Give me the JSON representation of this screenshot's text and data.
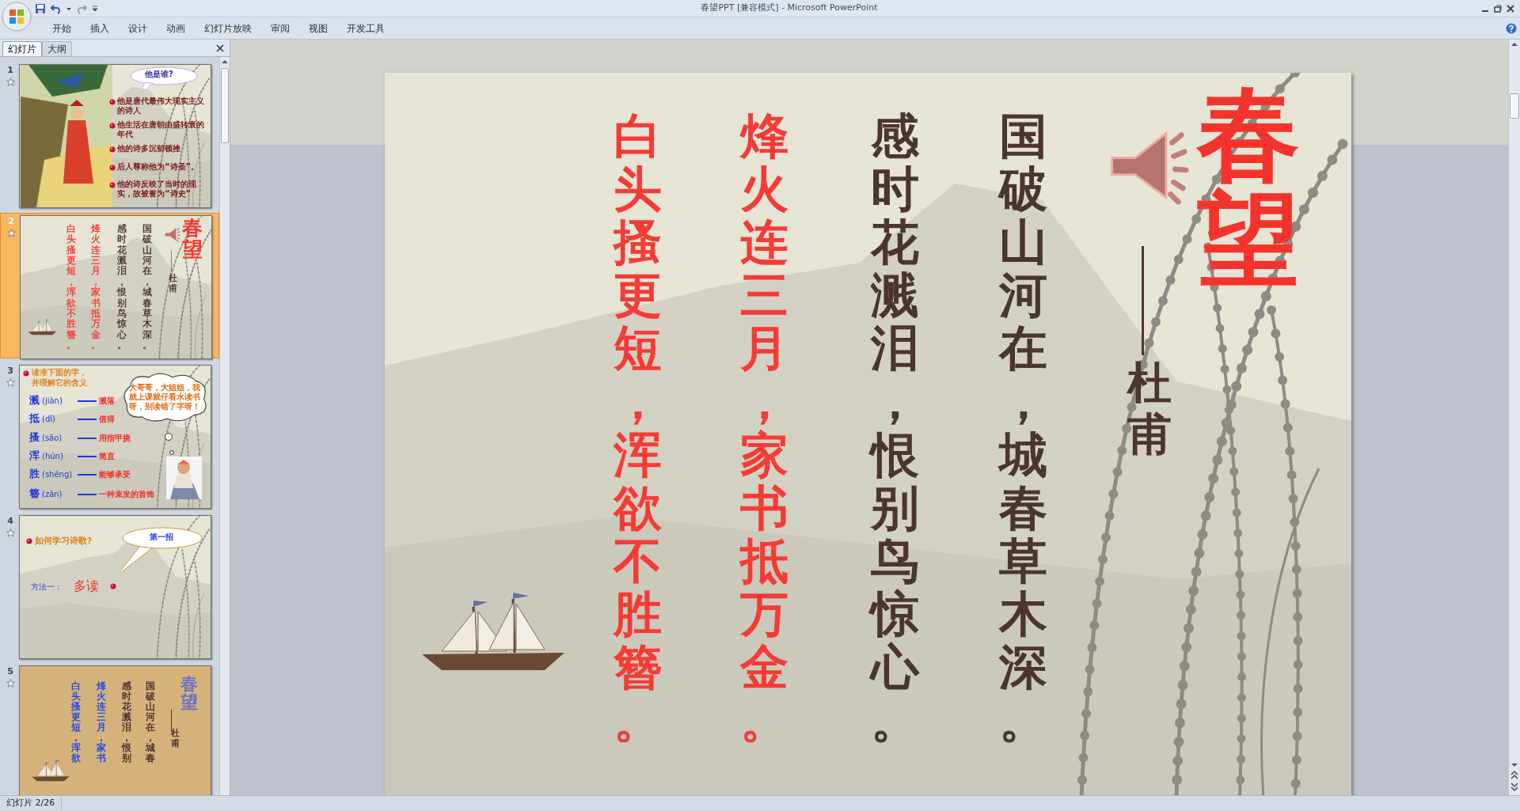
{
  "window": {
    "title": "春望PPT [兼容模式] - Microsoft PowerPoint"
  },
  "ribbon_tabs": [
    {
      "label": "开始"
    },
    {
      "label": "插入"
    },
    {
      "label": "设计"
    },
    {
      "label": "动画"
    },
    {
      "label": "幻灯片放映"
    },
    {
      "label": "审阅"
    },
    {
      "label": "视图"
    },
    {
      "label": "开发工具"
    }
  ],
  "pane_tabs": [
    {
      "label": "幻灯片",
      "selected": true
    },
    {
      "label": "大纲",
      "selected": false
    }
  ],
  "thumbnails": [
    {
      "number": "1",
      "selected": false,
      "kind": "intro",
      "bubble": "他是谁?",
      "bullets": [
        "他是唐代最伟大现实主义的诗人",
        "他生活在唐朝由盛转衰的年代",
        "他的诗多沉郁顿挫",
        "后人尊称他为“诗圣”。",
        "他的诗反映了当时的现实，故被誉为“诗史”"
      ]
    },
    {
      "number": "2",
      "selected": true,
      "kind": "poem",
      "title": "春望",
      "author": "杜甫",
      "lines": [
        {
          "text": "白头搔更短，浑欲不胜簪。",
          "color": "#f53b35"
        },
        {
          "text": "烽火连三月，家书抵万金。",
          "color": "#f53b35"
        },
        {
          "text": "感时花溅泪，恨别鸟惊心。",
          "color": "#4b3531"
        },
        {
          "text": "国破山河在，城春草木深。",
          "color": "#4b3531"
        }
      ]
    },
    {
      "number": "3",
      "selected": false,
      "kind": "vocabulary",
      "heading": "读准下面的字，并理解它的含义",
      "bubble": "大哥哥，大姐姐，我就上课就仔看水读书呀，别读错了字呀！",
      "rows": [
        {
          "char": "溅",
          "pinyin": "(jiàn)",
          "meaning": "溅落"
        },
        {
          "char": "抵",
          "pinyin": "(dǐ)",
          "meaning": "值得"
        },
        {
          "char": "搔",
          "pinyin": "(sāo)",
          "meaning": "用指甲挠"
        },
        {
          "char": "浑",
          "pinyin": "(hún)",
          "meaning": "简直"
        },
        {
          "char": "胜",
          "pinyin": "(shēng)",
          "meaning": "能够承受"
        },
        {
          "char": "簪",
          "pinyin": "(zān)",
          "meaning": "一种束发的首饰"
        }
      ]
    },
    {
      "number": "4",
      "selected": false,
      "kind": "method",
      "question": "如何学习诗歌?",
      "bubble": "第一招",
      "label": "方法一：",
      "answer": "多读"
    },
    {
      "number": "5",
      "selected": false,
      "kind": "draft",
      "title": "春望",
      "author": "杜甫",
      "lines": [
        {
          "text": "白头搔更短，浑欲",
          "color": "#2a4ae8"
        },
        {
          "text": "烽火连三月，家书",
          "color": "#2a4ae8"
        },
        {
          "text": "感时花溅泪，恨别",
          "color": "#4b3531"
        },
        {
          "text": "国破山河在，城春",
          "color": "#4b3531"
        }
      ]
    }
  ],
  "slide": {
    "title": "春望",
    "author": "杜甫",
    "lines": [
      {
        "text": "白头搔更短，浑欲不胜簪。",
        "color": "#f53b35"
      },
      {
        "text": "烽火连三月，家书抵万金。",
        "color": "#f53b35"
      },
      {
        "text": "感时花溅泪，恨别鸟惊心。",
        "color": "#4b3531"
      },
      {
        "text": "国破山河在，城春草木深。",
        "color": "#4b3531"
      }
    ]
  },
  "status_bar": {
    "text": "幻灯片 2/26"
  }
}
